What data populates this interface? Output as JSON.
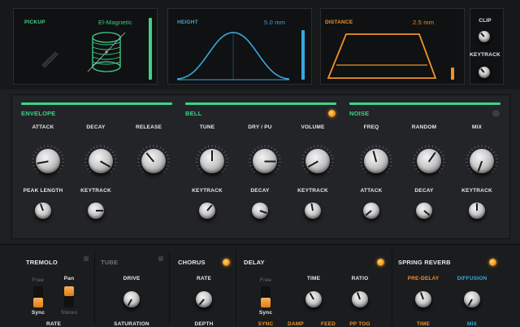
{
  "top": {
    "pickup": {
      "label": "PICKUP",
      "value": "El-Magnetic",
      "accent": "#3fd18a"
    },
    "height": {
      "label": "HEIGHT",
      "value": "5.0 mm",
      "accent": "#3aa8e0",
      "level": 0.8
    },
    "distance": {
      "label": "DISTANCE",
      "value": "2.5 mm",
      "accent": "#f0922a",
      "level": 0.2
    },
    "clip": {
      "label": "CLIP"
    },
    "keytrack": {
      "label": "KEYTRACK"
    }
  },
  "sections": {
    "envelope": {
      "title": "ENVELOPE",
      "knobs": [
        "ATTACK",
        "DECAY",
        "RELEASE"
      ],
      "small": [
        "PEAK LENGTH",
        "KEYTRACK"
      ]
    },
    "bell": {
      "title": "BELL",
      "knobs": [
        "TUNE",
        "DRY / PU",
        "VOLUME"
      ],
      "small": [
        "KEYTRACK",
        "DECAY",
        "KEYTRACK"
      ]
    },
    "noise": {
      "title": "NOISE",
      "knobs": [
        "FREQ",
        "RANDOM",
        "MIX"
      ],
      "small": [
        "ATTACK",
        "DECAY",
        "KEYTRACK"
      ]
    }
  },
  "fx": {
    "tremolo": {
      "title": "TREMOLO",
      "opt_a": "Free",
      "opt_b": "Pan",
      "opt_c": "Sync",
      "opt_d": "Stereo",
      "rate": "RATE"
    },
    "tube": {
      "title": "TUBE",
      "drive": "DRIVE",
      "saturation": "SATURATION"
    },
    "chorus": {
      "title": "CHORUS",
      "rate": "RATE",
      "depth": "DEPTH"
    },
    "delay": {
      "title": "DELAY",
      "opt_a": "Free",
      "opt_c": "Sync",
      "time": "TIME",
      "ratio": "RATIO",
      "b1": "SYNC",
      "b2": "DAMP",
      "b3": "FEED",
      "b4": "PP TOG"
    },
    "reverb": {
      "title": "SPRING REVERB",
      "predelay": "PRE-DELAY",
      "diffusion": "DIFFUSION",
      "b1": "TIME",
      "b2": "MIX"
    }
  }
}
